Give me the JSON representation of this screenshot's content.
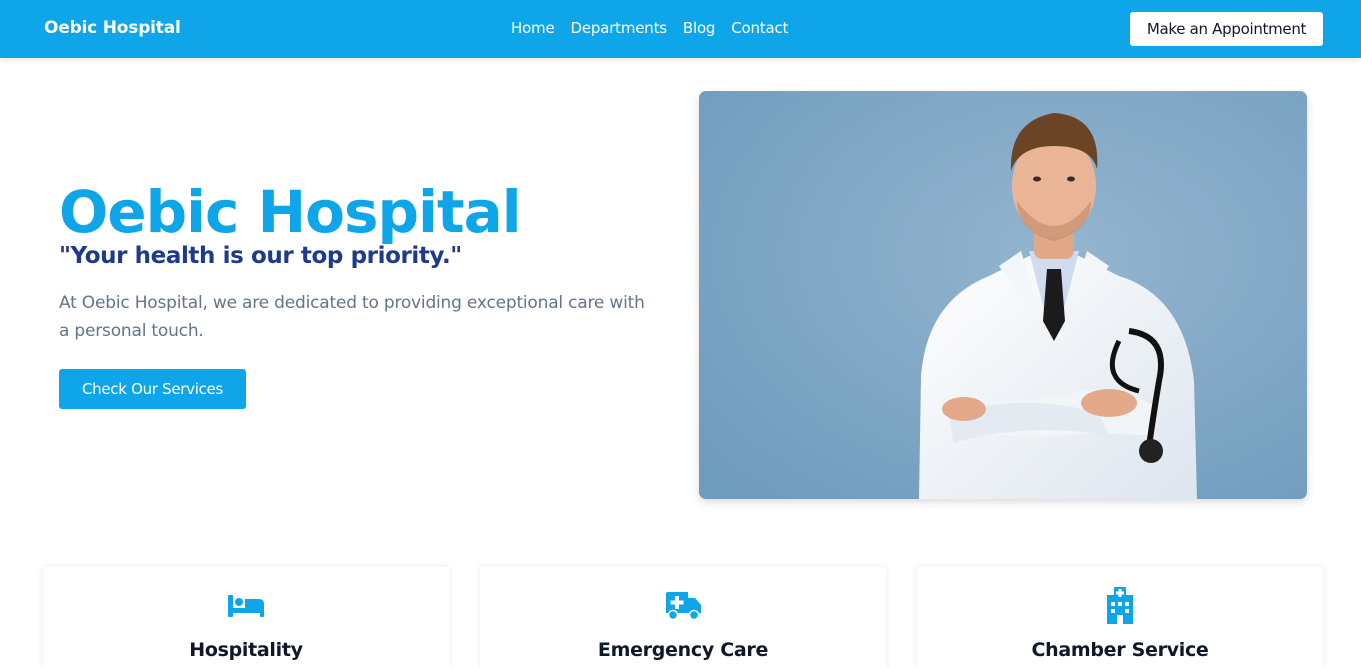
{
  "header": {
    "brand": "Oebic Hospital",
    "nav": [
      "Home",
      "Departments",
      "Blog",
      "Contact"
    ],
    "cta": "Make an Appointment"
  },
  "hero": {
    "title": "Oebic Hospital",
    "tagline": "\"Your health is our top priority.\"",
    "description": "At Oebic Hospital, we are dedicated to providing exceptional care with a personal touch.",
    "button": "Check Our Services",
    "image_icon": "doctor-photo"
  },
  "services": [
    {
      "icon": "bed-icon",
      "title": "Hospitality"
    },
    {
      "icon": "ambulance-icon",
      "title": "Emergency Care"
    },
    {
      "icon": "hospital-building-icon",
      "title": "Chamber Service"
    }
  ],
  "colors": {
    "primary": "#0ea5e9",
    "tagline": "#1e3a8a",
    "muted_text": "#64748b",
    "photo_background": "#7ea6c5"
  }
}
